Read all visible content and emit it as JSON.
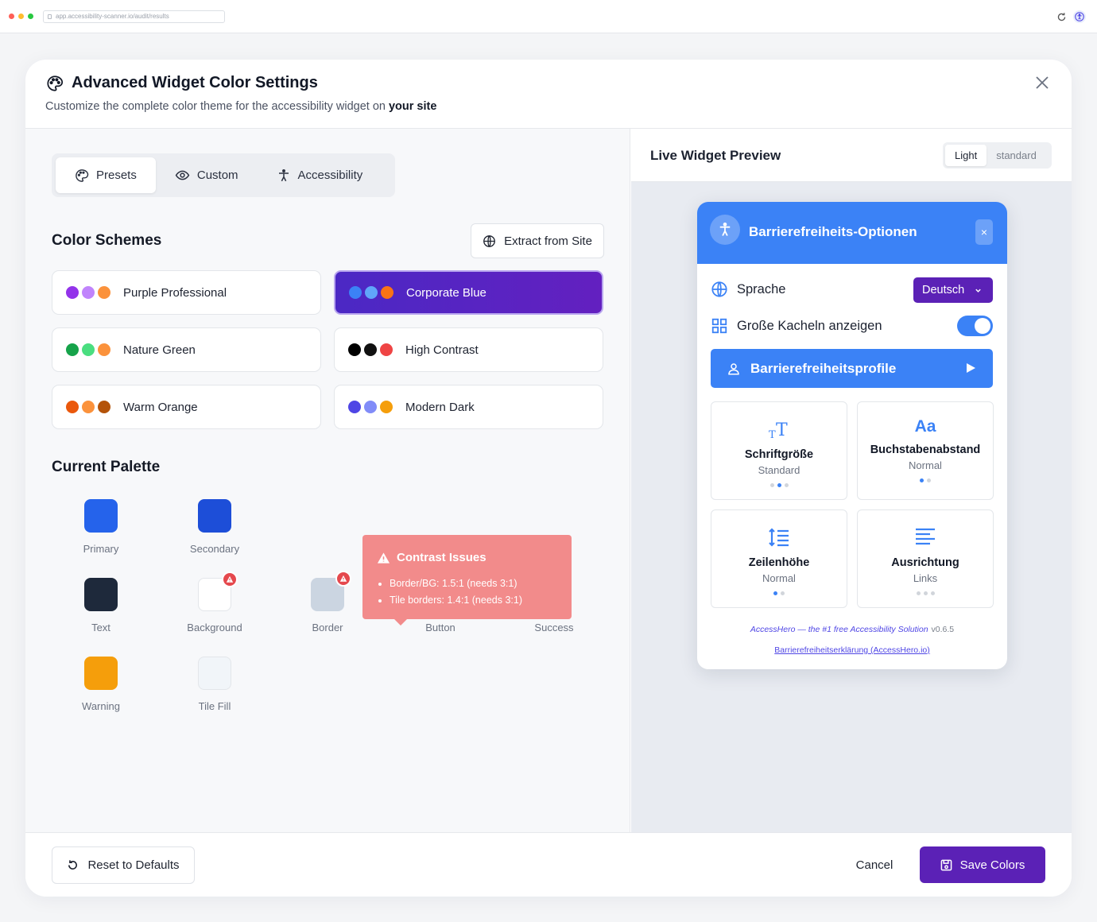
{
  "browser": {
    "url": "app.accessibility-scanner.io/audit/results",
    "dot_colors": [
      "#ff5f57",
      "#febc2e",
      "#28c840"
    ]
  },
  "modal": {
    "title": "Advanced Widget Color Settings",
    "subtitle_prefix": "Customize the complete color theme for the accessibility widget on ",
    "subtitle_bold": "your site",
    "title_icon": "palette-icon",
    "close_icon": "close-icon"
  },
  "tabs": [
    {
      "label": "Presets",
      "icon": "palette-icon",
      "active": true
    },
    {
      "label": "Custom",
      "icon": "eye-icon",
      "active": false
    },
    {
      "label": "Accessibility",
      "icon": "accessibility-person-icon",
      "active": false
    }
  ],
  "color_schemes": {
    "title": "Color Schemes",
    "extract_label": "Extract from Site",
    "items": [
      {
        "label": "Purple Professional",
        "colors": [
          "#9333ea",
          "#c084fc",
          "#fb923c"
        ],
        "active": false
      },
      {
        "label": "Corporate Blue",
        "colors": [
          "#3b82f6",
          "#60a5fa",
          "#f97316"
        ],
        "active": true
      },
      {
        "label": "Nature Green",
        "colors": [
          "#16a34a",
          "#4ade80",
          "#fb923c"
        ],
        "active": false
      },
      {
        "label": "High Contrast",
        "colors": [
          "#000000",
          "#111111",
          "#ef4444"
        ],
        "active": false
      },
      {
        "label": "Warm Orange",
        "colors": [
          "#ea580c",
          "#fb923c",
          "#b45309"
        ],
        "active": false
      },
      {
        "label": "Modern Dark",
        "colors": [
          "#4f46e5",
          "#818cf8",
          "#f59e0b"
        ],
        "active": false
      }
    ]
  },
  "palette": {
    "title": "Current Palette",
    "swatches": [
      {
        "name": "Primary",
        "color": "#2563eb",
        "warning": false
      },
      {
        "name": "Secondary",
        "color": "#1d4ed8",
        "warning": false
      },
      {
        "name": "Text",
        "color": "#1e293b",
        "warning": false
      },
      {
        "name": "Background",
        "color": "#ffffff",
        "warning": true
      },
      {
        "name": "Border",
        "color": "#cbd5e1",
        "warning": true
      },
      {
        "name": "Button",
        "color": "#3b82f6",
        "warning": false
      },
      {
        "name": "Success",
        "color": "#10b981",
        "warning": false
      },
      {
        "name": "Warning",
        "color": "#f59e0b",
        "warning": false
      },
      {
        "name": "Tile Fill",
        "color": "#f1f5f9",
        "warning": false
      }
    ]
  },
  "contrast_tooltip": {
    "title": "Contrast Issues",
    "issues": [
      "Border/BG: 1.5:1 (needs 3:1)",
      "Tile borders: 1.4:1 (needs 3:1)"
    ]
  },
  "preview": {
    "title": "Live Widget Preview",
    "modes": [
      {
        "label": "Light",
        "active": true
      },
      {
        "label": "standard",
        "active": false
      }
    ]
  },
  "widget": {
    "title": "Barrierefreiheits-Optionen",
    "close_label": "×",
    "language_label": "Sprache",
    "language_value": "Deutsch",
    "large_tiles_label": "Große Kacheln anzeigen",
    "large_tiles_on": true,
    "profiles_label": "Barrierefreiheitsprofile",
    "tiles": [
      {
        "name": "Schriftgröße",
        "value": "Standard",
        "icon": "text-size-icon",
        "dots": 3,
        "active_dot": 1
      },
      {
        "name": "Buchstabenabstand",
        "value": "Normal",
        "icon": "letter-spacing-icon",
        "icon_text": "Aa",
        "dots": 2,
        "active_dot": 0
      },
      {
        "name": "Zeilenhöhe",
        "value": "Normal",
        "icon": "line-height-icon",
        "dots": 2,
        "active_dot": 0
      },
      {
        "name": "Ausrichtung",
        "value": "Links",
        "icon": "align-left-icon",
        "dots": 3,
        "active_dot": -1
      }
    ],
    "footer_text": "AccessHero — the #1 free Accessibility Solution",
    "version": "v0.6.5",
    "statement_link": "Barrierefreiheitserklärung (AccessHero.io)",
    "accent": "#3b82f6"
  },
  "footer": {
    "reset_label": "Reset to Defaults",
    "cancel_label": "Cancel",
    "save_label": "Save Colors",
    "save_color": "#5b21b6"
  }
}
